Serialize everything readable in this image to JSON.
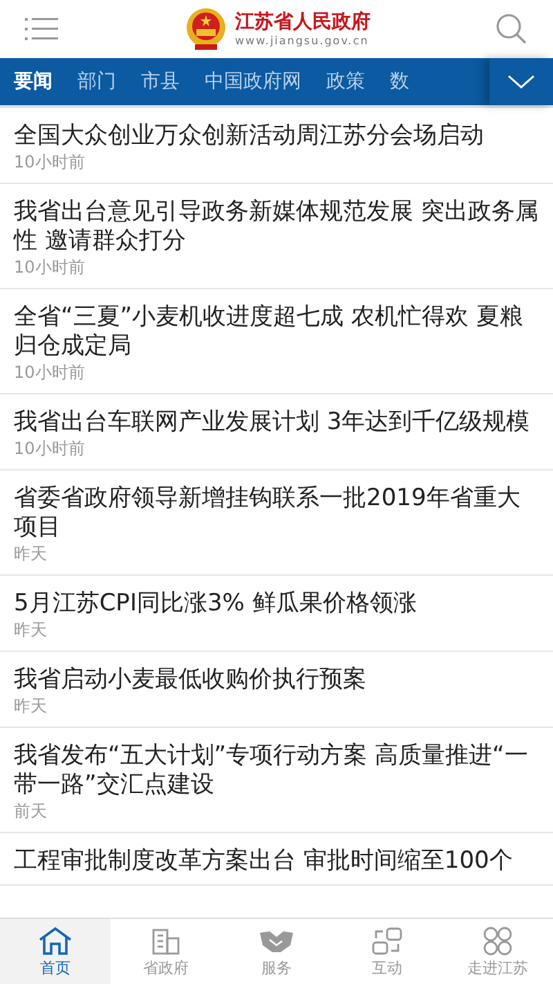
{
  "header": {
    "site_name": "江苏省人民政府",
    "site_url": "www.jiangsu.gov.cn"
  },
  "tabs": [
    {
      "label": "要闻",
      "selected": true
    },
    {
      "label": "部门",
      "selected": false
    },
    {
      "label": "市县",
      "selected": false
    },
    {
      "label": "中国政府网",
      "selected": false
    },
    {
      "label": "政策",
      "selected": false
    },
    {
      "label": "数",
      "selected": false
    }
  ],
  "news": [
    {
      "title": "全国大众创业万众创新活动周江苏分会场启动",
      "time": "10小时前"
    },
    {
      "title": "我省出台意见引导政务新媒体规范发展 突出政务属性 邀请群众打分",
      "time": "10小时前"
    },
    {
      "title": "全省“三夏”小麦机收进度超七成 农机忙得欢 夏粮归仓成定局",
      "time": "10小时前"
    },
    {
      "title": "我省出台车联网产业发展计划 3年达到千亿级规模",
      "time": "10小时前"
    },
    {
      "title": "省委省政府领导新增挂钩联系一批2019年省重大项目",
      "time": "昨天"
    },
    {
      "title": "5月江苏CPI同比涨3% 鲜瓜果价格领涨",
      "time": "昨天"
    },
    {
      "title": "我省启动小麦最低收购价执行预案",
      "time": "昨天"
    },
    {
      "title": "我省发布“五大计划”专项行动方案 高质量推进“一带一路”交汇点建设",
      "time": "前天"
    },
    {
      "title": "工程审批制度改革方案出台 审批时间缩至100个"
    }
  ],
  "bottom_nav": [
    {
      "label": "首页",
      "selected": true
    },
    {
      "label": "省政府",
      "selected": false
    },
    {
      "label": "服务",
      "selected": false
    },
    {
      "label": "互动",
      "selected": false
    },
    {
      "label": "走进江苏",
      "selected": false
    }
  ]
}
